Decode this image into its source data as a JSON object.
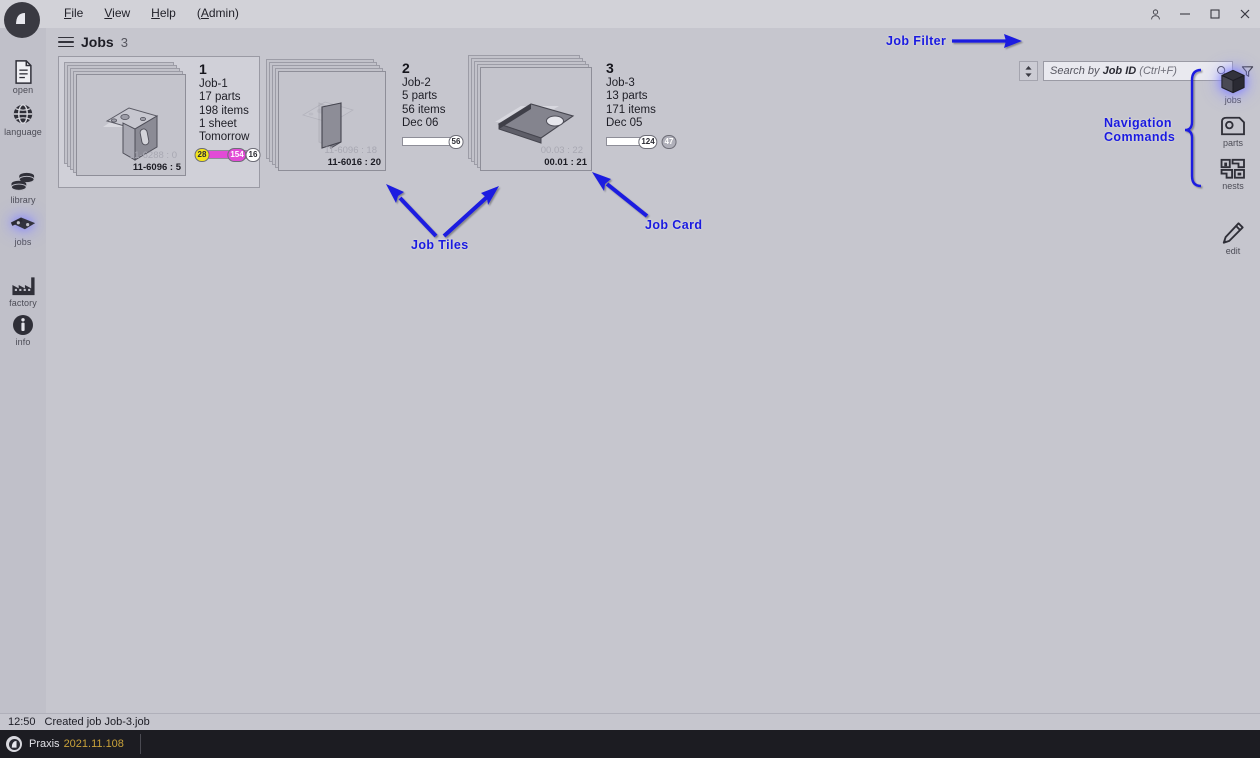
{
  "window": {
    "menu": [
      "File",
      "View",
      "Help",
      "(Admin)"
    ],
    "controls": {
      "account": "account-icon",
      "minimize": "minimize",
      "maximize": "maximize",
      "close": "close"
    }
  },
  "left_rail": {
    "items": [
      {
        "label": "open",
        "icon": "document-icon",
        "active": false
      },
      {
        "label": "language",
        "icon": "globe-icon",
        "active": false
      },
      {
        "label": "library",
        "icon": "coins-icon",
        "active": false
      },
      {
        "label": "jobs",
        "icon": "ticket-icon",
        "active": true
      },
      {
        "label": "factory",
        "icon": "factory-icon",
        "active": false
      },
      {
        "label": "info",
        "icon": "info-icon",
        "active": false
      }
    ]
  },
  "header": {
    "menu_icon": "hamburger-icon",
    "title": "Jobs",
    "count": "3"
  },
  "search": {
    "sort_icon": "sort-updown-icon",
    "placeholder_prefix": "Search by ",
    "placeholder_bold": "Job ID",
    "placeholder_hint": " (Ctrl+F)",
    "search_icon": "magnifier-icon",
    "filter_icon": "funnel-icon"
  },
  "tiles": [
    {
      "number": "1",
      "name": "Job-1",
      "parts": "17 parts",
      "items": "198 items",
      "sheets": "1 sheet",
      "due": "Tomorrow",
      "thumb_id": "11-6096 : 5",
      "thumb_id_ghost": "11-6288 : 0",
      "selected": true,
      "progress": {
        "chips": [
          {
            "value": "28",
            "color": "#f2e41a"
          },
          {
            "value": "154",
            "color": "#e24bd6"
          },
          {
            "value": "16",
            "color": "#ffffff"
          }
        ],
        "fill_color": "#e24bd6",
        "fill_pct": 72
      }
    },
    {
      "number": "2",
      "name": "Job-2",
      "parts": "5 parts",
      "items": "56 items",
      "sheets": "",
      "due": "Dec 06",
      "thumb_id": "11-6016 : 20",
      "thumb_id_ghost": "11-6096 : 18",
      "selected": false,
      "progress": {
        "chips": [
          {
            "value": "56",
            "color": "#ffffff"
          }
        ],
        "fill_color": "#ffffff",
        "fill_pct": 0
      }
    },
    {
      "number": "3",
      "name": "Job-3",
      "parts": "13 parts",
      "items": "171 items",
      "sheets": "",
      "due": "Dec 05",
      "thumb_id": "00.01 : 21",
      "thumb_id_ghost": "00.03 : 22",
      "selected": false,
      "progress": {
        "chips": [
          {
            "value": "124",
            "color": "#ffffff"
          },
          {
            "value": "47",
            "color": "#b0b0ba"
          }
        ],
        "fill_color": "#ffffff",
        "fill_pct": 0
      }
    }
  ],
  "right_nav": {
    "items": [
      {
        "label": "jobs",
        "icon": "box-icon",
        "active": true
      },
      {
        "label": "parts",
        "icon": "part-icon",
        "active": false
      },
      {
        "label": "nests",
        "icon": "nest-icon",
        "active": false
      }
    ],
    "edit": {
      "label": "edit",
      "icon": "pencil-icon"
    }
  },
  "annotations": [
    {
      "id": "job-filter",
      "text": "Job Filter"
    },
    {
      "id": "navigation-commands",
      "line1": "Navigation",
      "line2": "Commands"
    },
    {
      "id": "job-tiles",
      "text": "Job Tiles"
    },
    {
      "id": "job-card",
      "text": "Job Card"
    }
  ],
  "status": {
    "time": "12:50",
    "message": "Created job Job-3.job"
  },
  "taskbar": {
    "app_name": "Praxis",
    "version": "2021.11.108"
  },
  "colors": {
    "annotation": "#1a1ae0",
    "highlight": "#2323ff",
    "window_bg": "#c6c6ce",
    "titlebar_bg": "#d2d2d8",
    "taskbar_bg": "#1c1c22",
    "version_text": "#c9a23a"
  }
}
